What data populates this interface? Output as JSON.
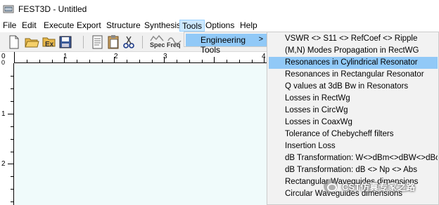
{
  "window": {
    "title": "FEST3D - Untitled"
  },
  "menubar": {
    "items": [
      "File",
      "Edit",
      "Execute",
      "Export",
      "Structure",
      "Synthesis",
      "Tools",
      "Options",
      "Help"
    ],
    "active": "Tools"
  },
  "toolbar": {
    "buttons": [
      "new-file-icon",
      "open-folder-icon",
      "exit-icon",
      "save-icon",
      "document-icon",
      "paste-icon",
      "cut-icon",
      "spec-icon",
      "freq-icon"
    ],
    "spec_label": "Spec",
    "freq_label": "Freq",
    "exit_label": "Ex"
  },
  "ruler": {
    "top_labels": [
      "0",
      "1",
      "2",
      "3",
      "4"
    ],
    "left_labels": [
      "0",
      "1",
      "2"
    ]
  },
  "tools_menu": {
    "engineering_tools_label": "Engineering Tools",
    "arrow": ">"
  },
  "engineering_tools": {
    "items": [
      "VSWR <> S11 <> RefCoef <> Ripple",
      "(M,N) Modes Propagation in RectWG",
      "Resonances in Cylindrical Resonator",
      "Resonances in Rectangular Resonator",
      "Q values at 3dB Bw in Resonators",
      "Losses in RectWg",
      "Losses in CircWg",
      "Losses in CoaxWg",
      "Tolerance of Chebycheff filters",
      "Insertion Loss",
      "dB Transformation: W<>dBm<>dBW<>dBc",
      "dB Transformation: dB <> Np <> Abs",
      "Rectangular Waveguides dimensions",
      "Circular Waveguides dimensions"
    ],
    "highlighted": "Resonances in Cylindrical Resonator"
  },
  "watermark": {
    "text": "CST仿真专家之路"
  },
  "colors": {
    "highlight": "#91c9f7",
    "canvas": "#f0fbfb",
    "menu_active": "#cce8ff"
  }
}
